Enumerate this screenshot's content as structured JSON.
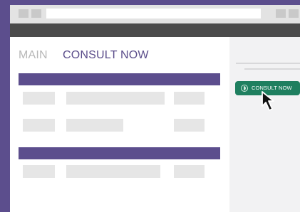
{
  "header": {
    "tabs": [
      {
        "label": "MAIN",
        "active": false
      },
      {
        "label": "CONSULT NOW",
        "active": true
      }
    ]
  },
  "sidebar": {
    "consult_button": {
      "label": "CONSULT NOW",
      "icon": "toggle-icon"
    }
  },
  "colors": {
    "frame": "#5c4e8d",
    "accent_button": "#1f7f5f",
    "dark_bar": "#4b4b4b",
    "placeholder": "#e6e6e6"
  }
}
